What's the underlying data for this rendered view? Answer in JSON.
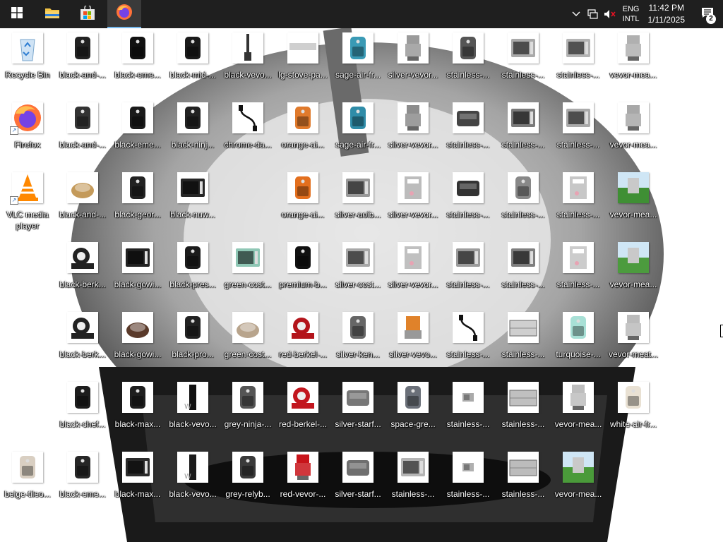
{
  "taskbar": {
    "start_icon": "windows-logo-icon",
    "pinned": [
      {
        "name": "file-explorer",
        "icon": "folder-icon"
      },
      {
        "name": "microsoft-store",
        "icon": "store-bag-icon"
      },
      {
        "name": "firefox",
        "icon": "firefox-icon",
        "active": true
      }
    ],
    "tray": {
      "chevron_icon": "chevron-up-icon",
      "network_icon": "network-icon",
      "volume_icon": "volume-muted-icon",
      "lang_top": "ENG",
      "lang_bottom": "INTL",
      "time": "11:42 PM",
      "date": "1/11/2025",
      "notification_count": "2"
    }
  },
  "desktop": {
    "columns": [
      [
        {
          "label": "Recycle Bin",
          "kind": "recycle"
        },
        {
          "label": "Firefox",
          "kind": "firefox",
          "shortcut": true
        },
        {
          "label": "VLC media player",
          "kind": "vlc",
          "shortcut": true
        },
        null,
        null,
        null,
        {
          "label": "beige-tileo...",
          "kind": "airfryer",
          "color": "#d9cfc2"
        }
      ],
      [
        {
          "label": "black-and-...",
          "kind": "airfryer",
          "color": "#222"
        },
        {
          "label": "black-and-...",
          "kind": "airfryer",
          "color": "#333"
        },
        {
          "label": "black-and-...",
          "kind": "food",
          "color": "#c49a5a"
        },
        {
          "label": "black-berk...",
          "kind": "slicer",
          "color": "#222"
        },
        {
          "label": "black-berk...",
          "kind": "slicer",
          "color": "#222"
        },
        {
          "label": "black-chef...",
          "kind": "airfryer",
          "color": "#1d1d1d"
        },
        {
          "label": "black-eme...",
          "kind": "airfryer",
          "color": "#262626"
        }
      ],
      [
        {
          "label": "black-eme...",
          "kind": "airfryer",
          "color": "#111"
        },
        {
          "label": "black-eme...",
          "kind": "airfryer",
          "color": "#1a1a1a"
        },
        {
          "label": "black-geor...",
          "kind": "airfryer",
          "color": "#222"
        },
        {
          "label": "black-gowi...",
          "kind": "oven",
          "color": "#222"
        },
        {
          "label": "black-gowi...",
          "kind": "food",
          "color": "#5a3a2a"
        },
        {
          "label": "black-max...",
          "kind": "airfryer",
          "color": "#1e1e1e"
        },
        {
          "label": "black-max...",
          "kind": "oven",
          "color": "#2a2a2a"
        }
      ],
      [
        {
          "label": "black-mid-...",
          "kind": "airfryer",
          "color": "#1a1a1a"
        },
        {
          "label": "black-ninj...",
          "kind": "airfryer",
          "color": "#222"
        },
        {
          "label": "black-nuw...",
          "kind": "oven",
          "color": "#262626"
        },
        {
          "label": "black-pres...",
          "kind": "airfryer",
          "color": "#1c1c1c"
        },
        {
          "label": "black-pro...",
          "kind": "airfryer",
          "color": "#222"
        },
        {
          "label": "black-vevo...",
          "kind": "tall",
          "color": "#111"
        },
        {
          "label": "black-vevo...",
          "kind": "tall",
          "color": "#1a1a1a"
        }
      ],
      [
        {
          "label": "black-vevo...",
          "kind": "blender",
          "color": "#333"
        },
        {
          "label": "chrome-da...",
          "kind": "cable",
          "color": "#111"
        },
        null,
        {
          "label": "green-cost...",
          "kind": "oven",
          "color": "#8fc7b5"
        },
        {
          "label": "green-cost...",
          "kind": "food",
          "color": "#b8a48c"
        },
        {
          "label": "grey-ninja-...",
          "kind": "airfryer",
          "color": "#555"
        },
        {
          "label": "grey-relyb...",
          "kind": "airfryer",
          "color": "#3a3a3a"
        }
      ],
      [
        {
          "label": "lg-stove-pa...",
          "kind": "panel",
          "color": "#cfcfcf"
        },
        {
          "label": "orange-ai...",
          "kind": "airfryer",
          "color": "#e07a2c"
        },
        {
          "label": "orange-ai...",
          "kind": "airfryer",
          "color": "#e36f1e"
        },
        {
          "label": "premium-b...",
          "kind": "airfryer",
          "color": "#111"
        },
        {
          "label": "red-berkel-...",
          "kind": "slicer",
          "color": "#b3141b"
        },
        {
          "label": "red-berkel-...",
          "kind": "slicer",
          "color": "#c2161e"
        },
        {
          "label": "red-vevor-...",
          "kind": "machine",
          "color": "#c8141a"
        }
      ],
      [
        {
          "label": "sage-air-fr...",
          "kind": "airfryer",
          "color": "#3a9ab5"
        },
        {
          "label": "sage-air-fr...",
          "kind": "airfryer",
          "color": "#2f8ca8"
        },
        {
          "label": "silver-aoib...",
          "kind": "oven",
          "color": "#9a9a9a"
        },
        {
          "label": "silver-cost...",
          "kind": "oven",
          "color": "#a8a8a8"
        },
        {
          "label": "silver-ken...",
          "kind": "airfryer",
          "color": "#666"
        },
        {
          "label": "silver-starf...",
          "kind": "grill",
          "color": "#777"
        },
        {
          "label": "silver-starf...",
          "kind": "grill",
          "color": "#6f6f6f"
        }
      ],
      [
        {
          "label": "silver-vevor...",
          "kind": "machine",
          "color": "#9a9a9a"
        },
        {
          "label": "silver-vevor...",
          "kind": "machine",
          "color": "#8c8c8c"
        },
        {
          "label": "silver-vevor...",
          "kind": "icecream",
          "color": "#bcbcbc"
        },
        {
          "label": "silver-vevor...",
          "kind": "icecream",
          "color": "#c0c0c0"
        },
        {
          "label": "silver-vevo...",
          "kind": "juicer",
          "color": "#e0822a"
        },
        {
          "label": "space-gre...",
          "kind": "airfryer",
          "color": "#6b7079"
        },
        {
          "label": "stainless-...",
          "kind": "oven",
          "color": "#b5b5b5"
        }
      ],
      [
        {
          "label": "stainless-...",
          "kind": "airfryer",
          "color": "#555"
        },
        {
          "label": "stainless-...",
          "kind": "grill",
          "color": "#444"
        },
        {
          "label": "stainless-...",
          "kind": "grill",
          "color": "#333"
        },
        {
          "label": "stainless-...",
          "kind": "oven",
          "color": "#9c9c9c"
        },
        {
          "label": "stainless-...",
          "kind": "cable",
          "color": "#111"
        },
        {
          "label": "stainless-...",
          "kind": "small",
          "color": "#aaa"
        },
        {
          "label": "stainless-...",
          "kind": "small",
          "color": "#b0b0b0"
        }
      ],
      [
        {
          "label": "stainless-...",
          "kind": "oven",
          "color": "#a9a9a9"
        },
        {
          "label": "stainless-...",
          "kind": "oven",
          "color": "#7a7a7a"
        },
        {
          "label": "stainless-...",
          "kind": "airfryer",
          "color": "#888"
        },
        {
          "label": "stainless-...",
          "kind": "oven",
          "color": "#7e7e7e"
        },
        {
          "label": "stainless-...",
          "kind": "display",
          "color": "#bbb"
        },
        {
          "label": "stainless-...",
          "kind": "display",
          "color": "#a5a5a5"
        },
        {
          "label": "stainless-...",
          "kind": "display",
          "color": "#9f9f9f"
        }
      ],
      [
        {
          "label": "stainless-...",
          "kind": "oven",
          "color": "#b3b3b3"
        },
        {
          "label": "stainless-...",
          "kind": "oven",
          "color": "#aaaaaa"
        },
        {
          "label": "stainless-...",
          "kind": "icecream",
          "color": "#c7c7c7"
        },
        {
          "label": "stainless-...",
          "kind": "icecream",
          "color": "#cccccc"
        },
        {
          "label": "turquoise-...",
          "kind": "airfryer",
          "color": "#a8e0d6"
        },
        {
          "label": "vevor-mea...",
          "kind": "machine",
          "color": "#bdbdbd"
        },
        {
          "label": "vevor-mea...",
          "kind": "grass",
          "color": "#4a9a3a"
        }
      ],
      [
        {
          "label": "vevor-mea...",
          "kind": "machine",
          "color": "#b0b0b0"
        },
        {
          "label": "vevor-mea...",
          "kind": "machine",
          "color": "#a8a8a8"
        },
        {
          "label": "vevor-mea...",
          "kind": "grass",
          "color": "#3f8f34"
        },
        {
          "label": "vevor-mea...",
          "kind": "grass",
          "color": "#4c9b3e"
        },
        {
          "label": "vevor-meat...",
          "kind": "machine",
          "color": "#bbbbbb"
        },
        {
          "label": "white-air-fr...",
          "kind": "airfryer",
          "color": "#e9e1d3"
        },
        null
      ]
    ]
  },
  "colors": {
    "taskbar": "#1f1f1f",
    "accent": "#76b9ed",
    "label_text": "#ffffff"
  }
}
